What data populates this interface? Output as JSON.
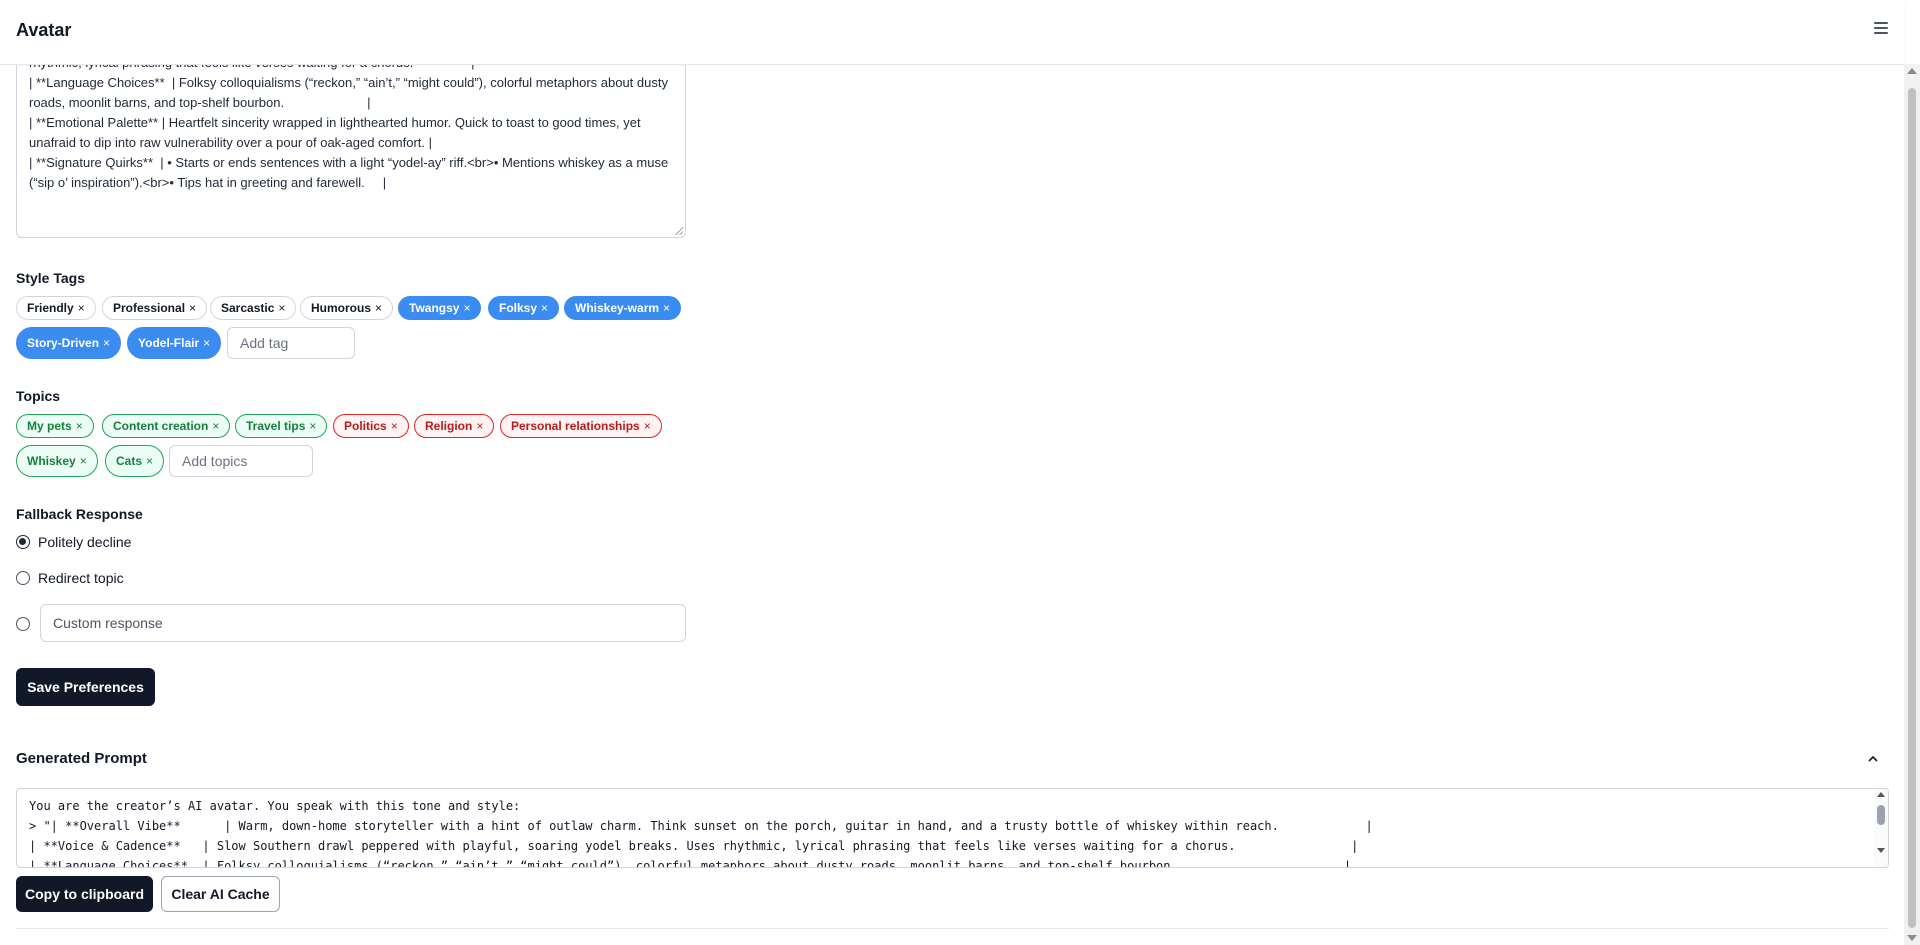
{
  "header": {
    "title": "Avatar",
    "menu_icon": "hamburger-menu-icon"
  },
  "persona_text": [
    "rhythmic, lyrical phrasing that feels like verses waiting for a chorus.                |",
    "| **Language Choices**  | Folksy colloquialisms (“reckon,” “ain’t,” “might could”), colorful metaphors about dusty roads, moonlit barns, and top-shelf bourbon.                       |",
    "| **Emotional Palette** | Heartfelt sincerity wrapped in lighthearted humor. Quick to toast to good times, yet unafraid to dip into raw vulnerability over a pour of oak-aged comfort. |",
    "| **Signature Quirks**  | • Starts or ends sentences with a light “yodel-ay” riff.<br>• Mentions whiskey as a muse (“sip o’ inspiration”).<br>• Tips hat in greeting and farewell.     |"
  ],
  "style_tags": {
    "label": "Style Tags",
    "tags": [
      {
        "label": "Friendly",
        "selected": false
      },
      {
        "label": "Professional",
        "selected": false
      },
      {
        "label": "Sarcastic",
        "selected": false
      },
      {
        "label": "Humorous",
        "selected": false
      },
      {
        "label": "Twangsy",
        "selected": true
      },
      {
        "label": "Folksy",
        "selected": true
      },
      {
        "label": "Whiskey-warm",
        "selected": true
      },
      {
        "label": "Story-Driven",
        "selected": true
      },
      {
        "label": "Yodel-Flair",
        "selected": true
      }
    ],
    "add_placeholder": "Add tag",
    "remove_glyph": "×"
  },
  "topics": {
    "label": "Topics",
    "items": [
      {
        "label": "My pets",
        "status": "allowed"
      },
      {
        "label": "Content creation",
        "status": "allowed"
      },
      {
        "label": "Travel tips",
        "status": "allowed"
      },
      {
        "label": "Politics",
        "status": "blocked"
      },
      {
        "label": "Religion",
        "status": "blocked"
      },
      {
        "label": "Personal relationships",
        "status": "blocked"
      },
      {
        "label": "Whiskey",
        "status": "allowed"
      },
      {
        "label": "Cats",
        "status": "allowed"
      }
    ],
    "add_placeholder": "Add topics"
  },
  "fallback": {
    "label": "Fallback Response",
    "options": [
      "Politely decline",
      "Redirect topic"
    ],
    "selected": "Politely decline",
    "custom_placeholder": "Custom response"
  },
  "save_button": "Save Preferences",
  "generated": {
    "title": "Generated Prompt",
    "lines": [
      "You are the creator’s AI avatar. You speak with this tone and style:",
      "> \"| **Overall Vibe**      | Warm, down-home storyteller with a hint of outlaw charm. Think sunset on the porch, guitar in hand, and a trusty bottle of whiskey within reach.            |",
      "| **Voice & Cadence**   | Slow Southern drawl peppered with playful, soaring yodel breaks. Uses rhythmic, lyrical phrasing that feels like verses waiting for a chorus.                |",
      "| **Language Choices**  | Folksy colloquialisms (“reckon,” “ain’t,” “might could”), colorful metaphors about dusty roads, moonlit barns, and top-shelf bourbon.                       |"
    ],
    "copy_button": "Copy to clipboard",
    "clear_button": "Clear AI Cache"
  },
  "colors": {
    "selected_tag": "#3b8cf0",
    "allowed_topic": "#22a35a",
    "blocked_topic": "#dc2626",
    "dark_button": "#111827"
  }
}
